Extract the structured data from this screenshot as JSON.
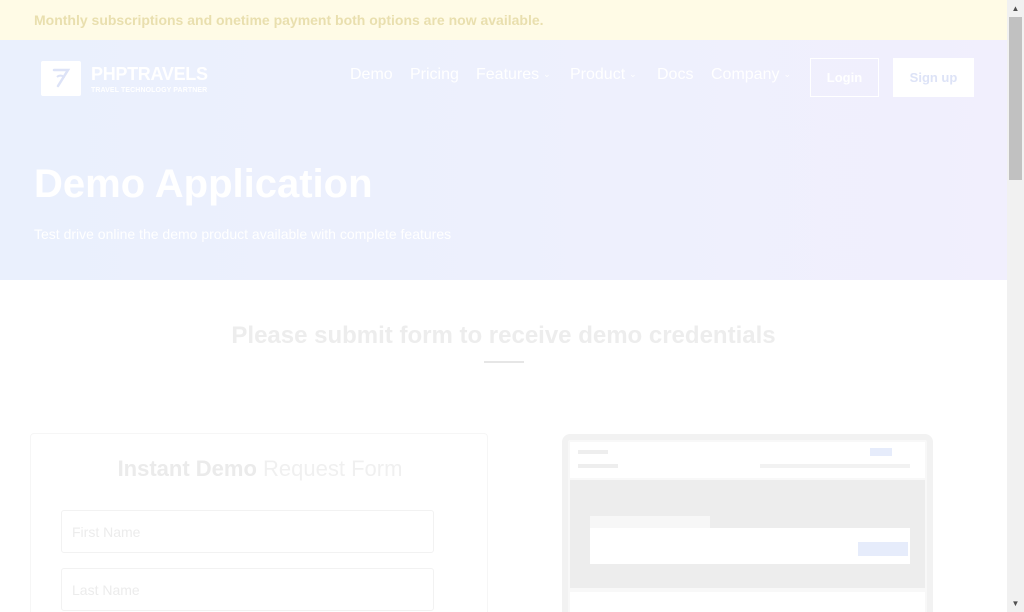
{
  "notice": {
    "text": "Monthly subscriptions and onetime payment both options are now available."
  },
  "brand": {
    "name": "PHPTRAVELS",
    "tagline": "TRAVEL TECHNOLOGY PARTNER",
    "icon": "logo-icon"
  },
  "nav": {
    "items": [
      {
        "label": "Demo",
        "has_dropdown": false
      },
      {
        "label": "Pricing",
        "has_dropdown": false
      },
      {
        "label": "Features",
        "has_dropdown": true
      },
      {
        "label": "Product",
        "has_dropdown": true
      },
      {
        "label": "Docs",
        "has_dropdown": false
      },
      {
        "label": "Company",
        "has_dropdown": true
      }
    ],
    "chevron": "⌄",
    "login_label": "Login",
    "signup_label": "Sign up"
  },
  "hero": {
    "title": "Demo Application",
    "subtitle": "Test drive online the demo product available with complete features"
  },
  "section": {
    "title": "Please submit form to receive demo credentials"
  },
  "form": {
    "title_bold": "Instant Demo",
    "title_light": "Request Form",
    "first_name_placeholder": "First Name",
    "last_name_placeholder": "Last Name"
  },
  "colors": {
    "notice_bg": "#fffbe6",
    "hero_bg": "#eaf0fd",
    "accent": "#e6ecfb"
  }
}
